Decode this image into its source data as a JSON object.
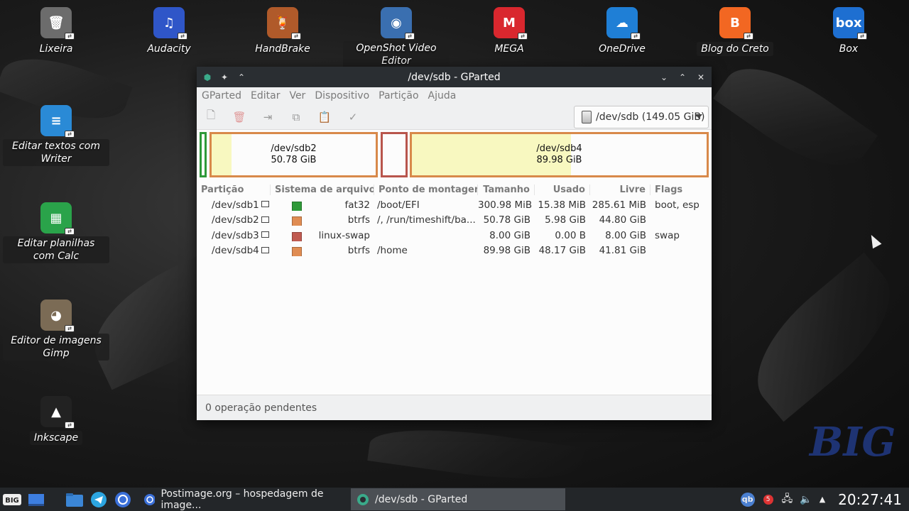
{
  "desktop": {
    "icons": [
      {
        "label": "Lixeira",
        "color": "#6c6c6c",
        "symbol": "🗑"
      },
      {
        "label": "Audacity",
        "color": "#2f56c8",
        "symbol": "♫"
      },
      {
        "label": "HandBrake",
        "color": "#b05a2a",
        "symbol": "🍹"
      },
      {
        "label": "OpenShot Video Editor",
        "color": "#3a6fb0",
        "symbol": "◉"
      },
      {
        "label": "MEGA",
        "color": "#d9272e",
        "symbol": "M"
      },
      {
        "label": "OneDrive",
        "color": "#1f7fd6",
        "symbol": "☁"
      },
      {
        "label": "Blog do Creto",
        "color": "#f26722",
        "symbol": "B"
      },
      {
        "label": "Box",
        "color": "#1e6fd1",
        "symbol": "box"
      },
      {
        "label": "Editar textos com Writer",
        "color": "#2a8ad6",
        "symbol": "≡"
      },
      {
        "label": "Editar planilhas com Calc",
        "color": "#2aa34a",
        "symbol": "▦"
      },
      {
        "label": "Editor de imagens Gimp",
        "color": "#7b6b55",
        "symbol": "◕"
      },
      {
        "label": "Inkscape",
        "color": "#222",
        "symbol": "▲"
      }
    ],
    "watermark": "BIG"
  },
  "window": {
    "title": "/dev/sdb - GParted",
    "menu": [
      "GParted",
      "Editar",
      "Ver",
      "Dispositivo",
      "Partição",
      "Ajuda"
    ],
    "device_selector": "/dev/sdb (149.05 GiB)",
    "map": [
      {
        "name": "/dev/sdb2",
        "size": "50.78 GiB",
        "used_frac": 0.12,
        "color": "#d8894a"
      },
      {
        "name": "/dev/sdb4",
        "size": "89.98 GiB",
        "used_frac": 0.54,
        "color": "#d8894a"
      }
    ],
    "columns": [
      "Partição",
      "Sistema de arquivos",
      "Ponto de montagem",
      "Tamanho",
      "Usado",
      "Livre",
      "Flags"
    ],
    "rows": [
      {
        "part": "/dev/sdb1",
        "fs": "fat32",
        "fs_color": "#2f9a39",
        "mount": "/boot/EFI",
        "size": "300.98 MiB",
        "used": "15.38 MiB",
        "free": "285.61 MiB",
        "flags": "boot, esp"
      },
      {
        "part": "/dev/sdb2",
        "fs": "btrfs",
        "fs_color": "#e08c52",
        "mount": "/, /run/timeshift/ba...",
        "size": "50.78 GiB",
        "used": "5.98 GiB",
        "free": "44.80 GiB",
        "flags": ""
      },
      {
        "part": "/dev/sdb3",
        "fs": "linux-swap",
        "fs_color": "#c05a50",
        "mount": "",
        "size": "8.00 GiB",
        "used": "0.00 B",
        "free": "8.00 GiB",
        "flags": "swap"
      },
      {
        "part": "/dev/sdb4",
        "fs": "btrfs",
        "fs_color": "#e08c52",
        "mount": "/home",
        "size": "89.98 GiB",
        "used": "48.17 GiB",
        "free": "41.81 GiB",
        "flags": ""
      }
    ],
    "status": "0 operação pendentes"
  },
  "taskbar": {
    "tasks": [
      "Postimage.org – hospedagem de image...",
      "/dev/sdb - GParted"
    ],
    "tray_badge": "5",
    "clock": "20:27:41",
    "qb": "qb"
  }
}
